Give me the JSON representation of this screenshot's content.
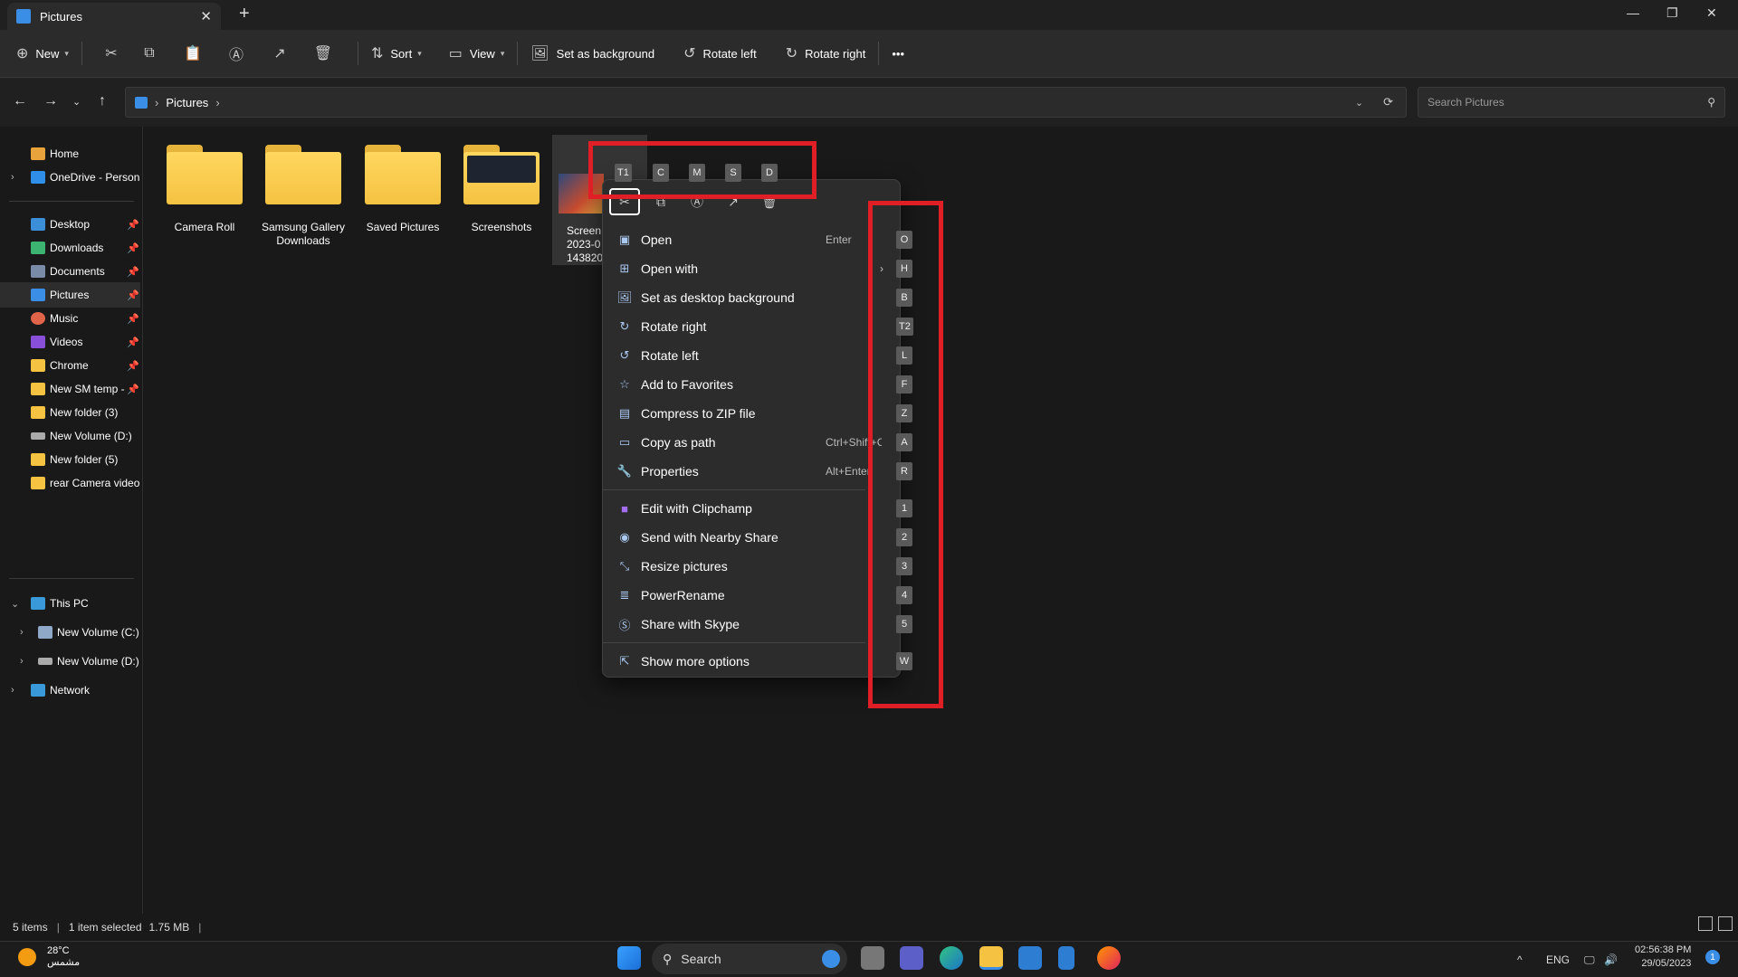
{
  "window": {
    "tab_title": "Pictures",
    "new_tab": "+",
    "close_tab": "✕",
    "minimize": "—",
    "maximize": "❐",
    "close": "✕"
  },
  "toolbar": {
    "new_label": "New",
    "sort_label": "Sort",
    "view_label": "View",
    "set_bg_label": "Set as background",
    "rotate_left_label": "Rotate left",
    "rotate_right_label": "Rotate right",
    "more_label": "•••"
  },
  "address": {
    "path_label": "Pictures",
    "search_placeholder": "Search Pictures"
  },
  "sidebar": {
    "items": [
      {
        "label": "Home",
        "color": "#e8a33d"
      },
      {
        "label": "OneDrive - Persona",
        "color": "#2f8fe8"
      },
      {
        "label": "Desktop",
        "color": "#3b8fd8"
      },
      {
        "label": "Downloads",
        "color": "#3cb371"
      },
      {
        "label": "Documents",
        "color": "#7a8ba8"
      },
      {
        "label": "Pictures",
        "color": "#3a8ee6"
      },
      {
        "label": "Music",
        "color": "#e0644a"
      },
      {
        "label": "Videos",
        "color": "#8a4fd8"
      },
      {
        "label": "Chrome",
        "color": "#f5c242"
      },
      {
        "label": "New SM temp -",
        "color": "#f5c242"
      },
      {
        "label": "New folder (3)",
        "color": "#f5c242"
      },
      {
        "label": "New Volume (D:)",
        "color": "#aaaaaa"
      },
      {
        "label": "New folder (5)",
        "color": "#f5c242"
      },
      {
        "label": "rear Camera video",
        "color": "#f5c242"
      },
      {
        "label": "This PC",
        "color": "#3a9ad9"
      },
      {
        "label": "New Volume (C:)",
        "color": "#8fa8c8"
      },
      {
        "label": "New Volume (D:)",
        "color": "#aaaaaa"
      },
      {
        "label": "Network",
        "color": "#3a9ad9"
      }
    ]
  },
  "files": {
    "items": [
      {
        "line1": "Camera Roll",
        "line2": ""
      },
      {
        "line1": "Samsung Gallery",
        "line2": "Downloads"
      },
      {
        "line1": "Saved Pictures",
        "line2": ""
      },
      {
        "line1": "Screenshots",
        "line2": ""
      }
    ],
    "selected": {
      "line1": "Screen",
      "line2": "2023-0",
      "line3": "143820"
    }
  },
  "context_menu": {
    "keytips_top": [
      "T1",
      "C",
      "M",
      "S",
      "D"
    ],
    "items": [
      {
        "label": "Open",
        "shortcut": "Enter",
        "key": "O"
      },
      {
        "label": "Open with",
        "shortcut": "",
        "key": "H"
      },
      {
        "label": "Set as desktop background",
        "shortcut": "",
        "key": "B"
      },
      {
        "label": "Rotate right",
        "shortcut": "",
        "key": "T2"
      },
      {
        "label": "Rotate left",
        "shortcut": "",
        "key": "L"
      },
      {
        "label": "Add to Favorites",
        "shortcut": "",
        "key": "F"
      },
      {
        "label": "Compress to ZIP file",
        "shortcut": "",
        "key": "Z"
      },
      {
        "label": "Copy as path",
        "shortcut": "Ctrl+Shift+C",
        "key": "A"
      },
      {
        "label": "Properties",
        "shortcut": "Alt+Enter",
        "key": "R"
      },
      {
        "label": "Edit with Clipchamp",
        "shortcut": "",
        "key": "1"
      },
      {
        "label": "Send with Nearby Share",
        "shortcut": "",
        "key": "2"
      },
      {
        "label": "Resize pictures",
        "shortcut": "",
        "key": "3"
      },
      {
        "label": "PowerRename",
        "shortcut": "",
        "key": "4"
      },
      {
        "label": "Share with Skype",
        "shortcut": "",
        "key": "5"
      },
      {
        "label": "Show more options",
        "shortcut": "",
        "key": "W"
      }
    ]
  },
  "status": {
    "items_count": "5 items",
    "selection": "1 item selected",
    "size": "1.75 MB"
  },
  "taskbar": {
    "temp": "28°C",
    "condition": "مشمس",
    "search_label": "Search",
    "lang": "ENG",
    "time": "02:56:38 PM",
    "date": "29/05/2023",
    "notif_count": "1"
  },
  "colors": {
    "highlight_red": "#e01e26",
    "accent_blue": "#3a8ee6"
  }
}
